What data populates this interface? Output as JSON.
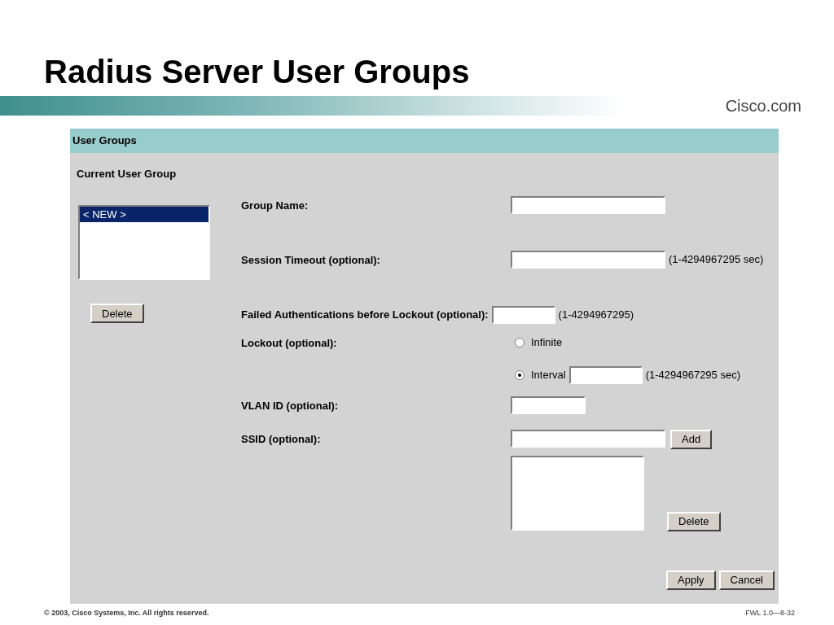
{
  "slide_title": "Radius Server User Groups",
  "banner": {
    "logo": "Cisco.com"
  },
  "panel": {
    "title": "User Groups",
    "current_group": {
      "label": "Current User Group",
      "items": [
        {
          "label": "< NEW >",
          "selected": true
        }
      ],
      "delete": "Delete"
    },
    "group_name": {
      "label": "Group Name:"
    },
    "session_timeout": {
      "label": "Session Timeout (optional):",
      "hint": "(1-4294967295 sec)"
    },
    "failed_auth": {
      "label": "Failed Authentications before Lockout (optional):",
      "hint": "(1-4294967295)"
    },
    "lockout": {
      "label": "Lockout (optional):",
      "options": [
        {
          "kind": "plain",
          "label": "Infinite",
          "selected": false
        },
        {
          "kind": "field",
          "label": "Interval",
          "selected": true,
          "hint": "(1-4294967295 sec)"
        }
      ]
    },
    "vlan": {
      "label": "VLAN ID (optional):"
    },
    "ssid": {
      "label": "SSID (optional):",
      "add": "Add",
      "delete": "Delete"
    },
    "buttons": [
      "Apply",
      "Cancel"
    ]
  },
  "footer": {
    "copyright": "© 2003, Cisco Systems, Inc. All rights reserved.",
    "code": "FWL 1.0—8-32"
  }
}
